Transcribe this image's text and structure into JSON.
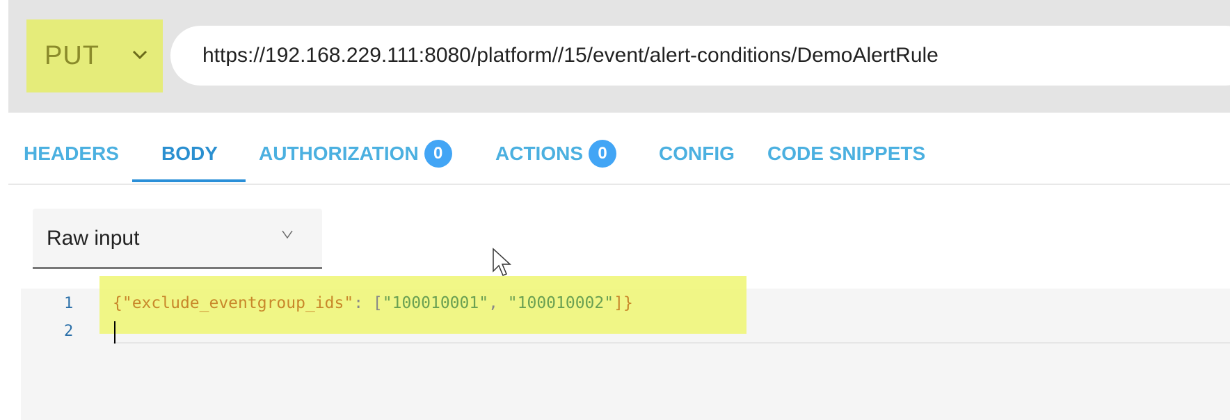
{
  "request": {
    "method": "PUT",
    "url": "https://192.168.229.111:8080/platform//15/event/alert-conditions/DemoAlertRule"
  },
  "tabs": [
    {
      "label": "HEADERS"
    },
    {
      "label": "BODY",
      "active": true
    },
    {
      "label": "AUTHORIZATION",
      "badge": "0"
    },
    {
      "label": "ACTIONS",
      "badge": "0"
    },
    {
      "label": "CONFIG"
    },
    {
      "label": "CODE SNIPPETS"
    }
  ],
  "body": {
    "input_type": "Raw input",
    "lines": [
      "1",
      "2"
    ],
    "code": {
      "open": "{",
      "key": "\"exclude_eventgroup_ids\"",
      "colon": ": [",
      "v1": "\"100010001\"",
      "comma": ", ",
      "v2": "\"100010002\"",
      "close": "]}"
    }
  },
  "colors": {
    "highlight": "#e5ec7a",
    "tab": "#4bb0e0",
    "badge": "#42a5f5"
  }
}
